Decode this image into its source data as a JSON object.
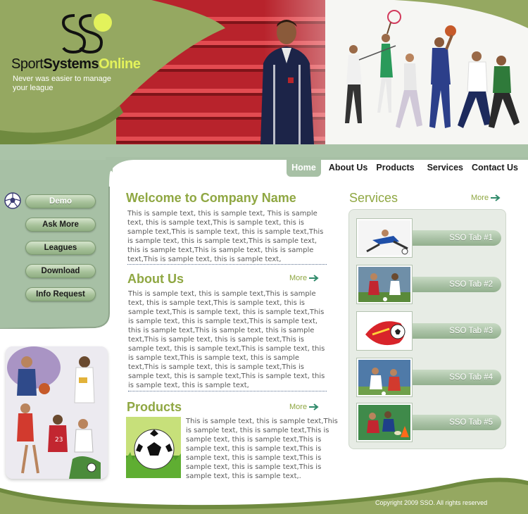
{
  "brand": {
    "name_part1": "Sport",
    "name_part2": "Systems",
    "name_part3": "Online",
    "tagline": "Never was easier to manage your league"
  },
  "nav": {
    "items": [
      {
        "label": "Home",
        "active": true
      },
      {
        "label": "About Us",
        "active": false
      },
      {
        "label": "Products",
        "active": false
      },
      {
        "label": "Services",
        "active": false
      },
      {
        "label": "Contact Us",
        "active": false
      }
    ]
  },
  "sidebar": {
    "menu": [
      {
        "label": "Demo"
      },
      {
        "label": "Ask More"
      },
      {
        "label": "Leagues"
      },
      {
        "label": "Download"
      },
      {
        "label": "Info Request"
      }
    ]
  },
  "main": {
    "welcome_title": "Welcome to Company Name",
    "welcome_text": "This is sample text, this is sample text, This is sample text, this is sample text,This is sample text, this is sample text,This is sample text, this is sample text,This is sample text, this is sample text,This is sample text, this is sample text,This is sample text, this is sample text,This is sample text, this is sample text,",
    "about_title": "About Us",
    "about_more": "More",
    "about_text": "This is sample text, this is sample text,This is sample text, this is sample text,This is sample text, this is sample text,This is sample text, this is sample text,This is sample text, this is sample text,This is sample text, this is sample text,This is sample text, this is sample text,This is sample text, this is sample text,This is sample text, this is sample text,This is sample text, this is sample text,This is sample text, this is sample text,This is sample text, this is sample text,This is sample text, this is sample text,This is sample text, this is sample text, this is sample text,",
    "products_title": "Products",
    "products_more": "More",
    "products_text": "This is sample text, this is sample text,This is sample text, this is sample text,This is sample text, this is sample text,This is sample text, this is sample text,This is sample text, this is sample text,This is sample text, this is sample text,This is sample text, this is sample text,."
  },
  "services": {
    "title": "Services",
    "more": "More",
    "tabs": [
      {
        "label": "SSO Tab #1",
        "thumb": "soccer-kick-icon"
      },
      {
        "label": "SSO Tab #2",
        "thumb": "soccer-match-icon"
      },
      {
        "label": "SSO Tab #3",
        "thumb": "soccer-ball-art-icon"
      },
      {
        "label": "SSO Tab #4",
        "thumb": "soccer-players-icon"
      },
      {
        "label": "SSO Tab #5",
        "thumb": "rugby-match-icon"
      }
    ]
  },
  "footer": {
    "copyright": "Copyright 2009 SSO. All rights reserved"
  },
  "colors": {
    "olive": "#95a861",
    "sage": "#a7c0a5",
    "heading_green": "#8fa742",
    "logo_lime": "#e3f25b"
  }
}
